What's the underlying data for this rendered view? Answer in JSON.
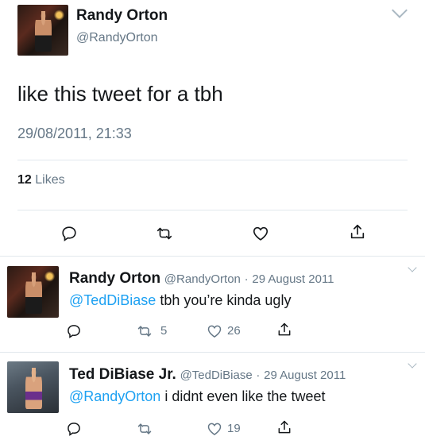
{
  "main_tweet": {
    "author_name": "Randy Orton",
    "author_handle": "@RandyOrton",
    "text": "like this tweet for a tbh",
    "timestamp": "29/08/2011, 21:33",
    "likes_count": "12",
    "likes_label": "Likes",
    "avatar_icon": "wrestler-avatar"
  },
  "replies": [
    {
      "author_name": "Randy Orton",
      "author_handle": "@RandyOrton",
      "date": "29 August 2011",
      "separator": "·",
      "mention": "@TedDiBiase",
      "text": "tbh you’re kinda ugly",
      "retweets": "5",
      "likes": "26"
    },
    {
      "author_name": "Ted DiBiase Jr.",
      "author_handle": "@TedDiBiase",
      "date": "29 August 2011",
      "separator": "·",
      "mention": "@RandyOrton",
      "text": "i didnt even like the tweet",
      "retweets": "",
      "likes": "19"
    }
  ],
  "icons": {
    "reply": "reply-icon",
    "retweet": "retweet-icon",
    "like": "heart-icon",
    "share": "share-icon",
    "more": "chevron-down-icon"
  },
  "colors": {
    "accent": "#1da1f2",
    "secondary_text": "#657786",
    "divider": "#e1e8ed"
  }
}
